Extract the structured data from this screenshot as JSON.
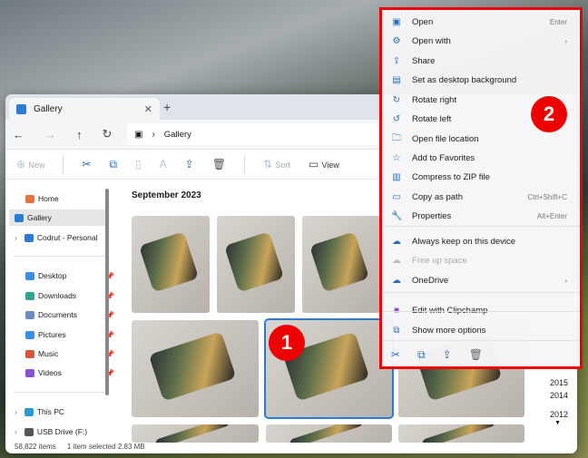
{
  "tab": {
    "title": "Gallery",
    "close": "✕",
    "new": "+"
  },
  "address": {
    "path": "Gallery"
  },
  "toolbar": {
    "new": "New",
    "sort": "Sort",
    "view": "View"
  },
  "sidebar": {
    "items": [
      {
        "label": "Home",
        "color": "#e8733a"
      },
      {
        "label": "Gallery",
        "color": "#2a7bd4"
      },
      {
        "label": "Codrut - Personal",
        "color": "#2a7bd4"
      },
      {
        "label": "Desktop",
        "color": "#3a8fe0",
        "pin": true
      },
      {
        "label": "Downloads",
        "color": "#2fa38e",
        "pin": true
      },
      {
        "label": "Documents",
        "color": "#6d8cc0",
        "pin": true
      },
      {
        "label": "Pictures",
        "color": "#3a8fe0",
        "pin": true
      },
      {
        "label": "Music",
        "color": "#d8553a",
        "pin": true
      },
      {
        "label": "Videos",
        "color": "#8b4fd6",
        "pin": true
      },
      {
        "label": "This PC",
        "color": "#2a9ad4"
      },
      {
        "label": "USB Drive (F:)",
        "color": "#555"
      }
    ]
  },
  "content": {
    "month": "September 2023",
    "years": [
      "2015",
      "2014",
      "2012"
    ],
    "year_arrow": "▼"
  },
  "status": {
    "count": "58,822 items",
    "selection": "1 item selected  2.83 MB"
  },
  "menu": {
    "items": [
      {
        "label": "Open",
        "shortcut": "Enter",
        "icon": "▣"
      },
      {
        "label": "Open with",
        "shortcut": "›",
        "icon": "⚙"
      },
      {
        "label": "Share",
        "icon": "⇪"
      },
      {
        "label": "Set as desktop background",
        "icon": "▤"
      },
      {
        "label": "Rotate right",
        "icon": "↻"
      },
      {
        "label": "Rotate left",
        "icon": "↺"
      },
      {
        "label": "Open file location",
        "icon": "🗀"
      },
      {
        "label": "Add to Favorites",
        "icon": "☆"
      },
      {
        "label": "Compress to ZIP file",
        "icon": "▥"
      },
      {
        "label": "Copy as path",
        "shortcut": "Ctrl+Shift+C",
        "icon": "▭"
      },
      {
        "label": "Properties",
        "shortcut": "Alt+Enter",
        "icon": "🔧"
      },
      {
        "label": "Always keep on this device",
        "icon": "☁"
      },
      {
        "label": "Free up space",
        "icon": "☁"
      },
      {
        "label": "OneDrive",
        "shortcut": "›",
        "icon": "☁"
      },
      {
        "label": "Edit with Clipchamp",
        "icon": "■"
      },
      {
        "label": "Show more options",
        "icon": "⧉"
      }
    ]
  },
  "badges": {
    "one": "1",
    "two": "2"
  }
}
